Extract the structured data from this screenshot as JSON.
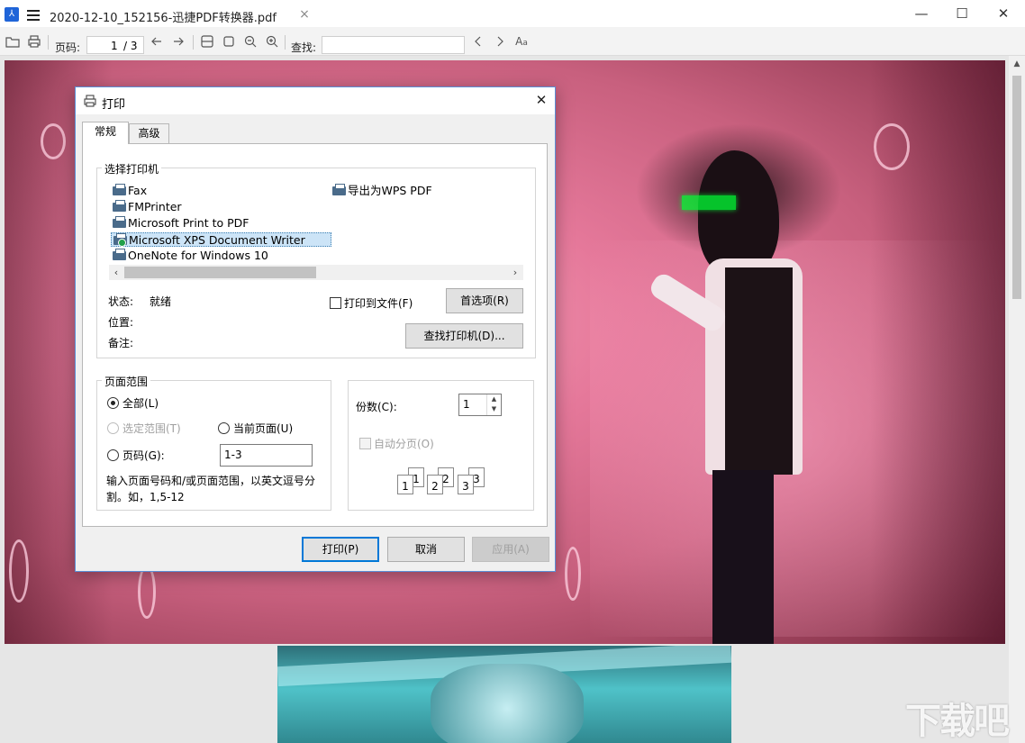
{
  "window": {
    "app_logo": "pdf-logo-icon",
    "doc_title": "2020-12-10_152156-迅捷PDF转换器.pdf",
    "tab_close": "×",
    "minimize": "—",
    "maximize": "☐",
    "close": "✕"
  },
  "toolbar": {
    "page_label": "页码:",
    "page_current": "1",
    "page_total": "/ 3",
    "find_label": "查找:",
    "find_value": ""
  },
  "dialog": {
    "title": "打印",
    "close": "✕",
    "tabs": [
      "常规",
      "高级"
    ],
    "printer_group_label": "选择打印机",
    "printers": [
      {
        "name": "Fax"
      },
      {
        "name": "FMPrinter"
      },
      {
        "name": "Microsoft Print to PDF"
      },
      {
        "name": "Microsoft XPS Document Writer",
        "selected": true
      },
      {
        "name": "OneNote for Windows 10"
      },
      {
        "name": "导出为WPS PDF"
      }
    ],
    "status_label": "状态:",
    "status_value": "就绪",
    "location_label": "位置:",
    "comment_label": "备注:",
    "print_to_file": "打印到文件(F)",
    "preferences": "首选项(R)",
    "find_printer": "查找打印机(D)...",
    "page_range_label": "页面范围",
    "range_all": "全部(L)",
    "range_selection": "选定范围(T)",
    "range_current": "当前页面(U)",
    "range_pages": "页码(G):",
    "range_pages_value": "1-3",
    "range_hint": "输入页面号码和/或页面范围，以英文逗号分割。如，1,5-12",
    "copies_label": "份数(C):",
    "copies_value": "1",
    "collate": "自动分页(O)",
    "collate_pages": [
      "1",
      "1",
      "2",
      "2",
      "3",
      "3"
    ],
    "print_button": "打印(P)",
    "cancel_button": "取消",
    "apply_button": "应用(A)"
  },
  "watermark": "下载吧"
}
